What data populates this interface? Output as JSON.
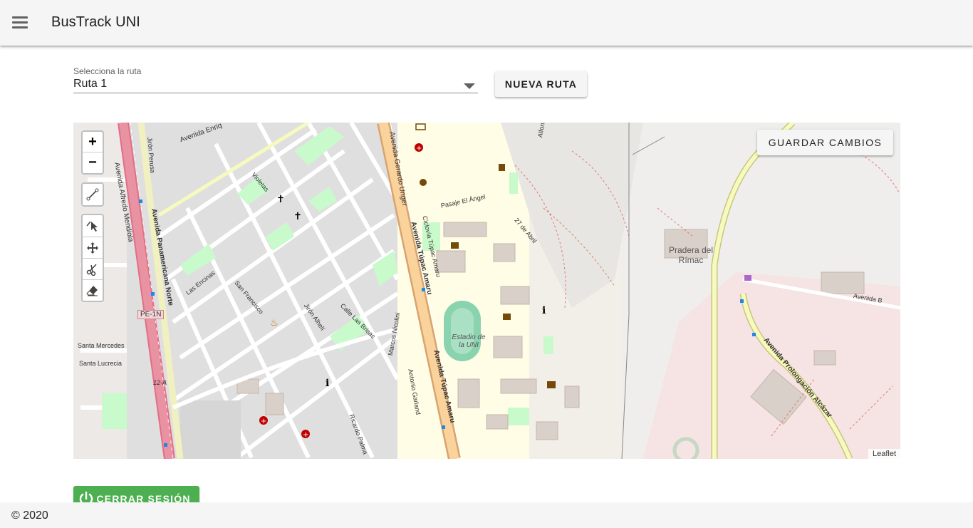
{
  "app": {
    "title": "BusTrack UNI",
    "menu_icon": "hamburger-menu-icon"
  },
  "route_select": {
    "label": "Selecciona la ruta",
    "value": "Ruta 1"
  },
  "buttons": {
    "new_route": "NUEVA RUTA",
    "save_changes": "GUARDAR CAMBIOS",
    "logout": "CERRAR SESIÓN"
  },
  "map": {
    "attribution": "Leaflet",
    "zoom_in": "+",
    "zoom_out": "−",
    "tools": [
      "draw-polyline-icon",
      "edit-vertex-icon",
      "move-icon",
      "cut-icon",
      "eraser-icon"
    ],
    "labels": {
      "av_tupac_amaru": "Avenida Túpac Amaru",
      "av_tupac_amaru_2": "Avenida Túpac Amaru",
      "av_gerardo_unger": "Avenida Gerardo Unger",
      "av_panamericana": "Avenida Panamericana Norte",
      "av_alfredo_mendiola": "Avenida Alfredo Mendiola",
      "av_prolongacion_alcazar": "Avenida Prolongación Alcázar",
      "av_enrique": "Avenida Enriq",
      "av_b": "Avenida B",
      "estadio": "Estadio de la UNI",
      "pradera": "Pradera del Rímac",
      "pasaje_el_angel": "Pasaje El Ángel",
      "27_abril": "27 de Abril",
      "alfonso_ugarte": "Alfonso Ugarte",
      "pe_1n": "PE-1N",
      "jiron_perusa": "Jirón Perusa",
      "las_encinas": "Las Encinas",
      "san_francisco": "San Francisco",
      "jiron_alheli": "Jirón Alhelí",
      "calle_las_brisas": "Calle Las Brisas",
      "santa_mercedes": "Santa Mercedes",
      "santa_lucrecia": "Santa Lucrecia",
      "violetas": "Violetas",
      "ciclovia": "Ciclovía Túpac Amaru",
      "ricardo_palma": "Ricardo Palma",
      "marcos_nicolini": "Marcos Nicolini",
      "antonio_garland": "Antonio Garland",
      "12a": "12-A"
    }
  },
  "footer": {
    "text": "© 2020"
  },
  "colors": {
    "appbar": "#f5f5f5",
    "logout_green": "#4caf50",
    "road_major": "#e892a2",
    "road_trunk": "#f9b29c",
    "road_secondary": "#f7fabf",
    "park": "#c8facc",
    "university": "#ffffe5",
    "military": "#f5dcdc"
  }
}
